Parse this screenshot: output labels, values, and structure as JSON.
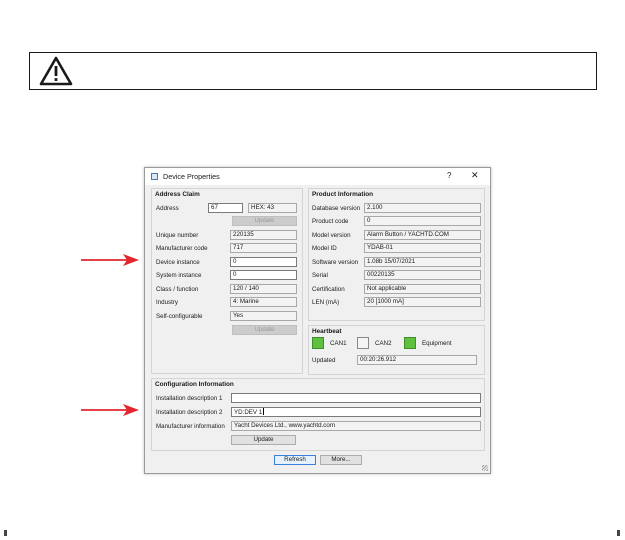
{
  "dialog": {
    "title": "Device Properties",
    "help": "?",
    "close": "✕"
  },
  "address_claim": {
    "title": "Address Claim",
    "address_label": "Address",
    "address_value": "67",
    "hex_value": "HEX: 43",
    "update_label": "Update",
    "unique_number_label": "Unique number",
    "unique_number_value": "220135",
    "manufacturer_code_label": "Manufacturer code",
    "manufacturer_code_value": "717",
    "device_instance_label": "Device instance",
    "device_instance_value": "0",
    "system_instance_label": "System instance",
    "system_instance_value": "0",
    "class_function_label": "Class / function",
    "class_function_value": "120 / 140",
    "industry_label": "Industry",
    "industry_value": "4: Marine",
    "self_configurable_label": "Self-configurable",
    "self_configurable_value": "Yes",
    "update2_label": "Update"
  },
  "product_information": {
    "title": "Product Information",
    "database_version_label": "Database version",
    "database_version_value": "2.100",
    "product_code_label": "Product code",
    "product_code_value": "0",
    "model_version_label": "Model version",
    "model_version_value": "Alarm Button / YACHTD.COM",
    "model_id_label": "Model ID",
    "model_id_value": "YDAB-01",
    "software_version_label": "Software version",
    "software_version_value": "1.08b 15/07/2021",
    "serial_label": "Serial",
    "serial_value": "00220135",
    "certification_label": "Certification",
    "certification_value": "Not applicable",
    "len_label": "LEN (mA)",
    "len_value": "20 [1000 mA]"
  },
  "heartbeat": {
    "title": "Heartbeat",
    "can1_label": "CAN1",
    "can2_label": "CAN2",
    "equipment_label": "Equipment",
    "can1_on": true,
    "can2_on": false,
    "equipment_on": true,
    "updated_label": "Updated",
    "updated_value": "00:20:26.912",
    "on_color": "#5fbf3e",
    "off_color": "#f4f4f4"
  },
  "configuration": {
    "title": "Configuration Information",
    "installation_1_label": "Installation description 1",
    "installation_1_value": "",
    "installation_2_label": "Installation description 2",
    "installation_2_value": "YD:DEV 1",
    "manufacturer_info_label": "Manufacturer information",
    "manufacturer_info_value": "Yacht Devices Ltd., www.yachtd.com",
    "update_label": "Update"
  },
  "footer": {
    "refresh_label": "Refresh",
    "more_label": "More..."
  },
  "annotations": {
    "arrow_color": "#e3262e",
    "warning_icon": "warning-triangle-icon"
  }
}
